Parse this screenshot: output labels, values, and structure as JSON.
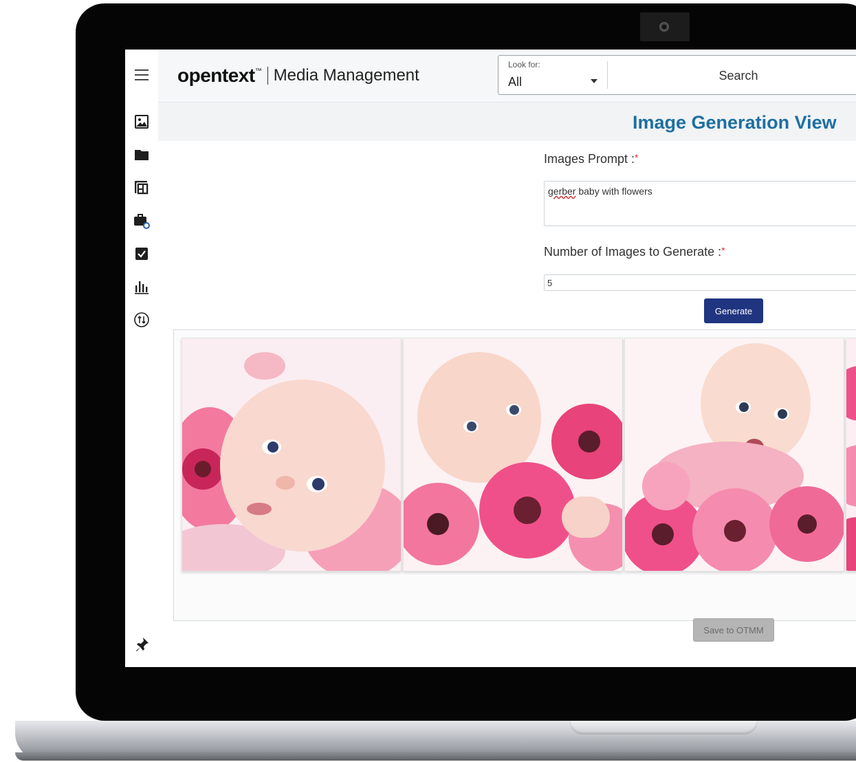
{
  "app": {
    "brand_name": "opentext",
    "brand_tm": "™",
    "product_name": "Media Management"
  },
  "search": {
    "lookfor_label": "Look for:",
    "lookfor_value": "All",
    "placeholder": "Search"
  },
  "sidebar": {
    "items": [
      {
        "icon": "menu-icon"
      },
      {
        "icon": "image-icon"
      },
      {
        "icon": "folder-icon"
      },
      {
        "icon": "collections-icon"
      },
      {
        "icon": "briefcase-search-icon"
      },
      {
        "icon": "checkbox-icon"
      },
      {
        "icon": "bar-chart-icon"
      },
      {
        "icon": "transfer-icon"
      },
      {
        "icon": "pin-icon"
      }
    ]
  },
  "page": {
    "title": "Image Generation View",
    "prompt_label": "Images Prompt :",
    "prompt_misspelled_word": "gerber",
    "prompt_rest": " baby with flowers",
    "count_label": "Number of Images to Generate :",
    "count_value": "5",
    "required_mark": "*",
    "generate_label": "Generate",
    "save_label": "Save to OTMM"
  },
  "results": {
    "images": [
      {
        "alt": "Baby lying among pink gerbera flowers"
      },
      {
        "alt": "Baby peeking over pink gerbera flowers"
      },
      {
        "alt": "Surprised baby on pink gerbera flowers"
      }
    ]
  },
  "colors": {
    "accent_title": "#1e6fa1",
    "generate_button": "#1f3580",
    "save_button_disabled": "#b5b5b5",
    "required": "#d03030",
    "flower_pink": "#f0508a"
  }
}
